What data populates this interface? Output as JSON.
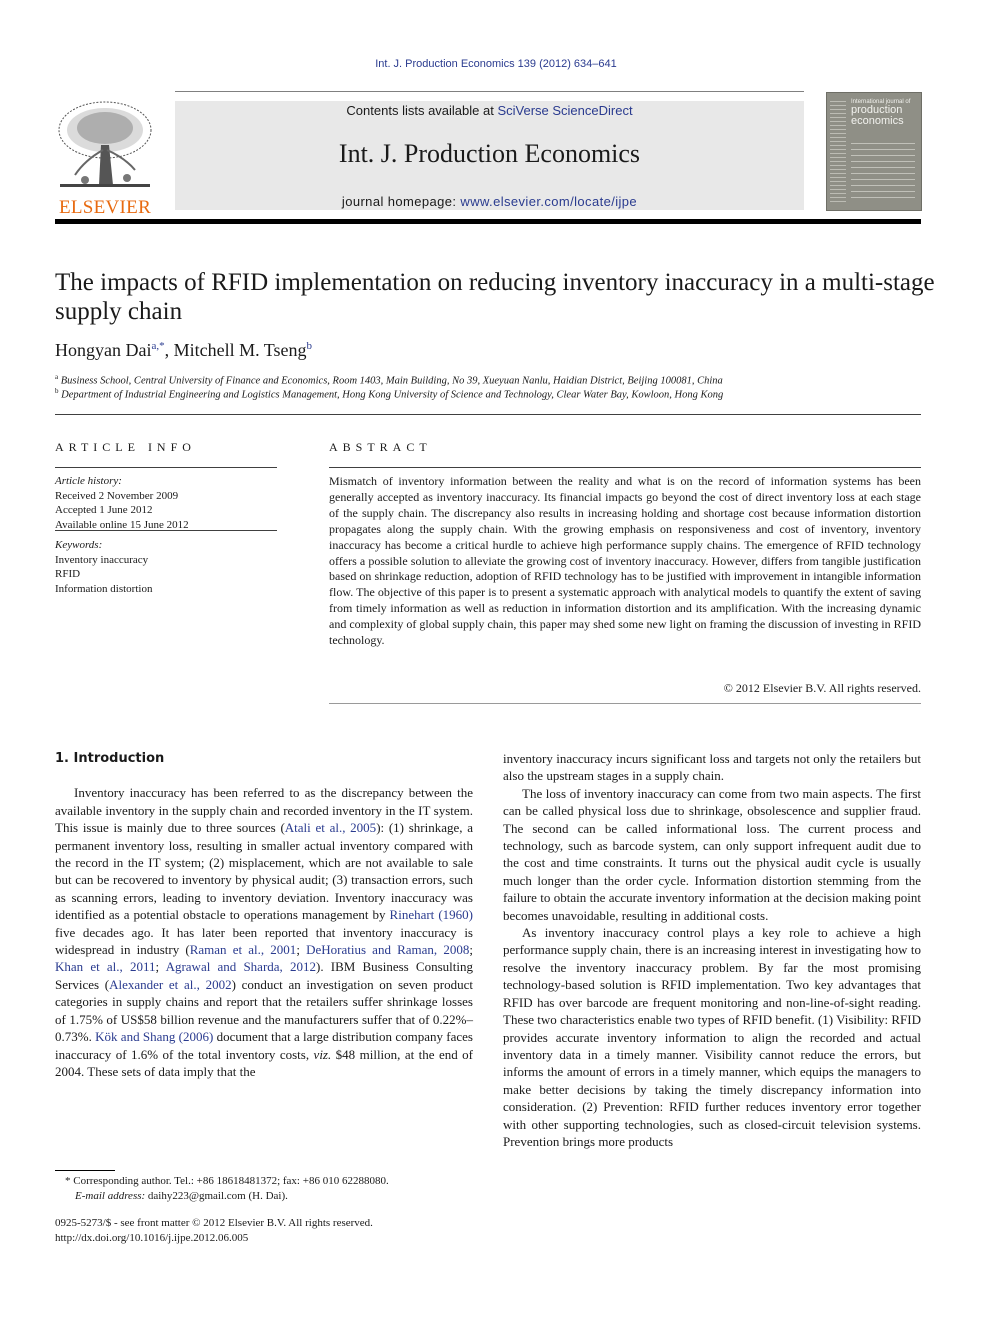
{
  "header": {
    "journal_ref": "Int. J. Production Economics 139 (2012) 634–641",
    "publisher_logo_text": "ELSEVIER",
    "contents_prefix": "Contents lists available at ",
    "contents_link": "SciVerse ScienceDirect",
    "journal_title": "Int. J. Production Economics",
    "homepage_prefix": "journal homepage: ",
    "homepage_link": "www.elsevier.com/locate/ijpe",
    "cover": {
      "small_line": "International journal of",
      "big_line1": "production",
      "big_line2": "economics"
    }
  },
  "article": {
    "title": "The impacts of RFID implementation on reducing inventory inaccuracy in a multi-stage supply chain",
    "authors": [
      {
        "name": "Hongyan Dai",
        "marks": "a,*",
        "sep": ", "
      },
      {
        "name": "Mitchell M. Tseng",
        "marks": "b",
        "sep": ""
      }
    ],
    "affiliations": [
      {
        "mark": "a",
        "text": "Business School, Central University of Finance and Economics, Room 1403, Main Building, No 39, Xueyuan Nanlu, Haidian District, Beijing 100081, China"
      },
      {
        "mark": "b",
        "text": "Department of Industrial Engineering and Logistics Management, Hong Kong University of Science and Technology, Clear Water Bay, Kowloon, Hong Kong"
      }
    ]
  },
  "article_info": {
    "label": "ARTICLE INFO",
    "history_label": "Article history:",
    "history": [
      "Received 2 November 2009",
      "Accepted 1 June 2012",
      "Available online 15 June 2012"
    ],
    "keywords_label": "Keywords:",
    "keywords": [
      "Inventory inaccuracy",
      "RFID",
      "Information distortion"
    ]
  },
  "abstract": {
    "label": "ABSTRACT",
    "text": "Mismatch of inventory information between the reality and what is on the record of information systems has been generally accepted as inventory inaccuracy. Its financial impacts go beyond the cost of direct inventory loss at each stage of the supply chain. The discrepancy also results in increasing holding and shortage cost because information distortion propagates along the supply chain. With the growing emphasis on responsiveness and cost of inventory, inventory inaccuracy has become a critical hurdle to achieve high performance supply chains. The emergence of RFID technology offers a possible solution to alleviate the growing cost of inventory inaccuracy. However, differs from tangible justification based on shrinkage reduction, adoption of RFID technology has to be justified with improvement in intangible information flow. The objective of this paper is to present a systematic approach with analytical models to quantify the extent of saving from timely information as well as reduction in information distortion and its amplification. With the increasing dynamic and complexity of global supply chain, this paper may shed some new light on framing the discussion of investing in RFID technology.",
    "copyright": "© 2012 Elsevier B.V. All rights reserved."
  },
  "body": {
    "section_heading": "1.  Introduction",
    "left_para": {
      "t1": "Inventory inaccuracy has been referred to as the discrepancy between the available inventory in the supply chain and recorded inventory in the IT system. This issue is mainly due to three sources (",
      "c1": "Atali et al., 2005",
      "t2": "): (1) shrinkage, a permanent inventory loss, resulting in smaller actual inventory compared with the record in the IT system; (2) misplacement, which are not available to sale but can be recovered to inventory by physical audit; (3) transaction errors, such as scanning errors, leading to inventory deviation. Inventory inaccuracy was identified as a potential obstacle to operations management by ",
      "c2": "Rinehart (1960)",
      "t3": " five decades ago. It has later been reported that inventory inaccuracy is widespread in industry (",
      "c3": "Raman et al., 2001",
      "s1": "; ",
      "c4": "DeHoratius and Raman, 2008",
      "s2": "; ",
      "c5": "Khan et al., 2011",
      "s3": "; ",
      "c6": "Agrawal and Sharda, 2012",
      "t4": "). IBM Business Consulting Services (",
      "c7": "Alexander et al., 2002",
      "t5": ") conduct an investigation on seven product categories in supply chains and report that the retailers suffer shrinkage losses of 1.75% of US$58 billion revenue and the manufacturers suffer that of 0.22%–0.73%. ",
      "c8": "Kök and Shang (2006)",
      "t6": " document that a large distribution company faces inaccuracy of 1.6% of the total inventory costs, ",
      "viz": "viz.",
      "t7": " $48 million, at the end of 2004. These sets of data imply that the"
    },
    "right_paras": [
      "inventory inaccuracy incurs significant loss and targets not only the retailers but also the upstream stages in a supply chain.",
      "The loss of inventory inaccuracy can come from two main aspects. The first can be called physical loss due to shrinkage, obsolescence and supplier fraud. The second can be called informational loss. The current process and technology, such as barcode system, can only support infrequent audit due to the cost and time constraints. It turns out the physical audit cycle is usually much longer than the order cycle. Information distortion stemming from the failure to obtain the accurate inventory information at the decision making point becomes unavoidable, resulting in additional costs.",
      "As inventory inaccuracy control plays a key role to achieve a high performance supply chain, there is an increasing interest in investigating how to resolve the inventory inaccuracy problem. By far the most promising technology-based solution is RFID implementation. Two key advantages that RFID has over barcode are frequent monitoring and non-line-of-sight reading. These two characteristics enable two types of RFID benefit. (1) Visibility: RFID provides accurate inventory information to align the recorded and actual inventory data in a timely manner. Visibility cannot reduce the errors, but informs the amount of errors in a timely manner, which equips the managers to make better decisions by taking the timely discrepancy information into consideration. (2) Prevention: RFID further reduces inventory error together with other supporting technologies, such as closed-circuit television systems. Prevention brings more products"
    ]
  },
  "footnotes": {
    "corresponding": "* Corresponding author. Tel.: +86 18618481372; fax: +86 010 62288080.",
    "email_label": "E-mail address:",
    "email_value": " daihy223@gmail.com (H. Dai).",
    "issn_line": "0925-5273/$ - see front matter © 2012 Elsevier B.V. All rights reserved.",
    "doi_line": "http://dx.doi.org/10.1016/j.ijpe.2012.06.005"
  }
}
